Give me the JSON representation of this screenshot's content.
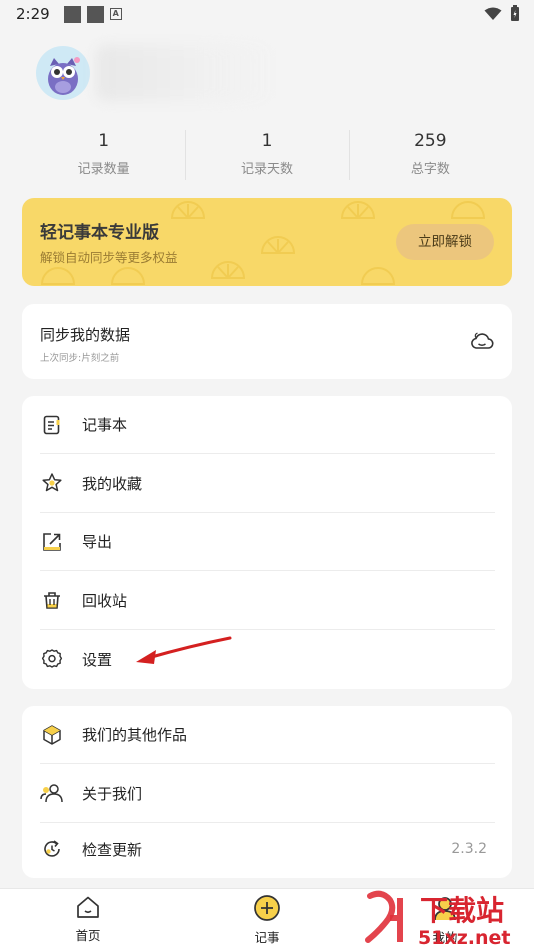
{
  "status_bar": {
    "time": "2:29"
  },
  "profile": {
    "avatar_icon": "owl-avatar-icon"
  },
  "stats": [
    {
      "value": "1",
      "label": "记录数量"
    },
    {
      "value": "1",
      "label": "记录天数"
    },
    {
      "value": "259",
      "label": "总字数"
    }
  ],
  "pro": {
    "title": "轻记事本专业版",
    "subtitle": "解锁自动同步等更多权益",
    "button": "立即解锁",
    "bg_color": "#f8d868"
  },
  "sync": {
    "title": "同步我的数据",
    "subtitle": "上次同步:片刻之前"
  },
  "menu_primary": [
    {
      "label": "记事本",
      "icon": "notebook-icon"
    },
    {
      "label": "我的收藏",
      "icon": "flower-star-icon"
    },
    {
      "label": "导出",
      "icon": "export-icon"
    },
    {
      "label": "回收站",
      "icon": "trash-icon"
    },
    {
      "label": "设置",
      "icon": "gear-icon"
    }
  ],
  "menu_secondary": [
    {
      "label": "我们的其他作品",
      "icon": "cube-icon"
    },
    {
      "label": "关于我们",
      "icon": "people-icon"
    },
    {
      "label": "检查更新",
      "icon": "refresh-clock-icon",
      "value": "2.3.2"
    }
  ],
  "tabbar": [
    {
      "label": "首页",
      "icon": "home-icon"
    },
    {
      "label": "记事",
      "icon": "add-circle-icon"
    },
    {
      "label": "我的",
      "icon": "user-icon"
    }
  ],
  "watermark": {
    "line1": "下载站",
    "line2": "51xz.net"
  },
  "accent_color": "#f7d04a"
}
